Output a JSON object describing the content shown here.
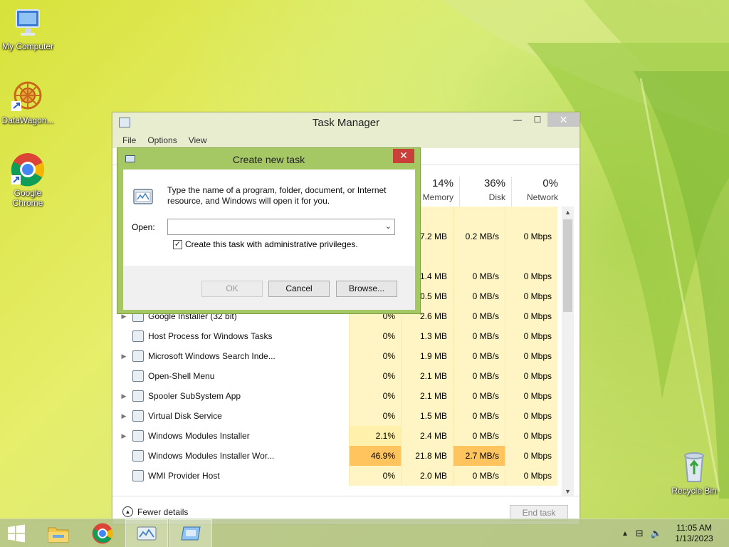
{
  "desktop": {
    "icons": [
      {
        "label": "My Computer",
        "icon": "computer-icon"
      },
      {
        "label": "DataWagon...",
        "icon": "datawagon-icon"
      },
      {
        "label": "Google Chrome",
        "icon": "chrome-icon"
      },
      {
        "label": "Recycle Bin",
        "icon": "recycle-bin-icon"
      }
    ]
  },
  "task_manager": {
    "title": "Task Manager",
    "menu": [
      "File",
      "Options",
      "View"
    ],
    "columns": {
      "memory": {
        "pct": "14%",
        "name": "Memory"
      },
      "disk": {
        "pct": "36%",
        "name": "Disk"
      },
      "network": {
        "pct": "0%",
        "name": "Network"
      }
    },
    "rows": [
      {
        "name": "",
        "cpu": "",
        "mem": "",
        "disk": "",
        "net": "",
        "expandable": false,
        "icon": ""
      },
      {
        "name": "",
        "cpu": "",
        "mem": "7.2 MB",
        "disk": "0.2 MB/s",
        "net": "0 Mbps",
        "expandable": false,
        "icon": ""
      },
      {
        "name": "",
        "cpu": "",
        "mem": "",
        "disk": "",
        "net": "",
        "expandable": false,
        "icon": ""
      },
      {
        "name": "",
        "cpu": "",
        "mem": "1.4 MB",
        "disk": "0 MB/s",
        "net": "0 Mbps",
        "expandable": false,
        "icon": ""
      },
      {
        "name": "",
        "cpu": "",
        "mem": "0.5 MB",
        "disk": "0 MB/s",
        "net": "0 Mbps",
        "expandable": false,
        "icon": ""
      },
      {
        "name": "Google Installer (32 bit)",
        "cpu": "0%",
        "mem": "2.6 MB",
        "disk": "0 MB/s",
        "net": "0 Mbps",
        "expandable": true,
        "icon": "installer-icon"
      },
      {
        "name": "Host Process for Windows Tasks",
        "cpu": "0%",
        "mem": "1.3 MB",
        "disk": "0 MB/s",
        "net": "0 Mbps",
        "expandable": false,
        "icon": "process-icon"
      },
      {
        "name": "Microsoft Windows Search Inde...",
        "cpu": "0%",
        "mem": "1.9 MB",
        "disk": "0 MB/s",
        "net": "0 Mbps",
        "expandable": true,
        "icon": "search-indexer-icon"
      },
      {
        "name": "Open-Shell Menu",
        "cpu": "0%",
        "mem": "2.1 MB",
        "disk": "0 MB/s",
        "net": "0 Mbps",
        "expandable": false,
        "icon": "shell-icon"
      },
      {
        "name": "Spooler SubSystem App",
        "cpu": "0%",
        "mem": "2.1 MB",
        "disk": "0 MB/s",
        "net": "0 Mbps",
        "expandable": true,
        "icon": "printer-icon"
      },
      {
        "name": "Virtual Disk Service",
        "cpu": "0%",
        "mem": "1.5 MB",
        "disk": "0 MB/s",
        "net": "0 Mbps",
        "expandable": true,
        "icon": "process-icon"
      },
      {
        "name": "Windows Modules Installer",
        "cpu": "2.1%",
        "mem": "2.4 MB",
        "disk": "0 MB/s",
        "net": "0 Mbps",
        "expandable": true,
        "icon": "process-icon"
      },
      {
        "name": "Windows Modules Installer Wor...",
        "cpu": "46.9%",
        "mem": "21.8 MB",
        "disk": "2.7 MB/s",
        "net": "0 Mbps",
        "expandable": false,
        "icon": "process-icon"
      },
      {
        "name": "WMI Provider Host",
        "cpu": "0%",
        "mem": "2.0 MB",
        "disk": "0 MB/s",
        "net": "0 Mbps",
        "expandable": false,
        "icon": "wmi-icon"
      }
    ],
    "footer": {
      "fewer_details": "Fewer details",
      "end_task": "End task"
    },
    "colors": {
      "cell_bg": "#fff4c4",
      "hot": "#ffc45e",
      "warm": "#fff0ac"
    }
  },
  "dialog": {
    "title": "Create new task",
    "description": "Type the name of a program, folder, document, or Internet resource, and Windows will open it for you.",
    "open_label": "Open:",
    "open_value": "",
    "checkbox_label": "Create this task with administrative privileges.",
    "checkbox_checked": true,
    "ok": "OK",
    "cancel": "Cancel",
    "browse": "Browse...",
    "colors": {
      "frame": "#a5c864",
      "close": "#c9403a"
    }
  },
  "taskbar": {
    "items": [
      "start-button",
      "file-explorer-icon",
      "chrome-icon",
      "task-manager-icon",
      "run-dialog-icon"
    ],
    "clock": {
      "time": "11:05 AM",
      "date": "1/13/2023"
    }
  }
}
